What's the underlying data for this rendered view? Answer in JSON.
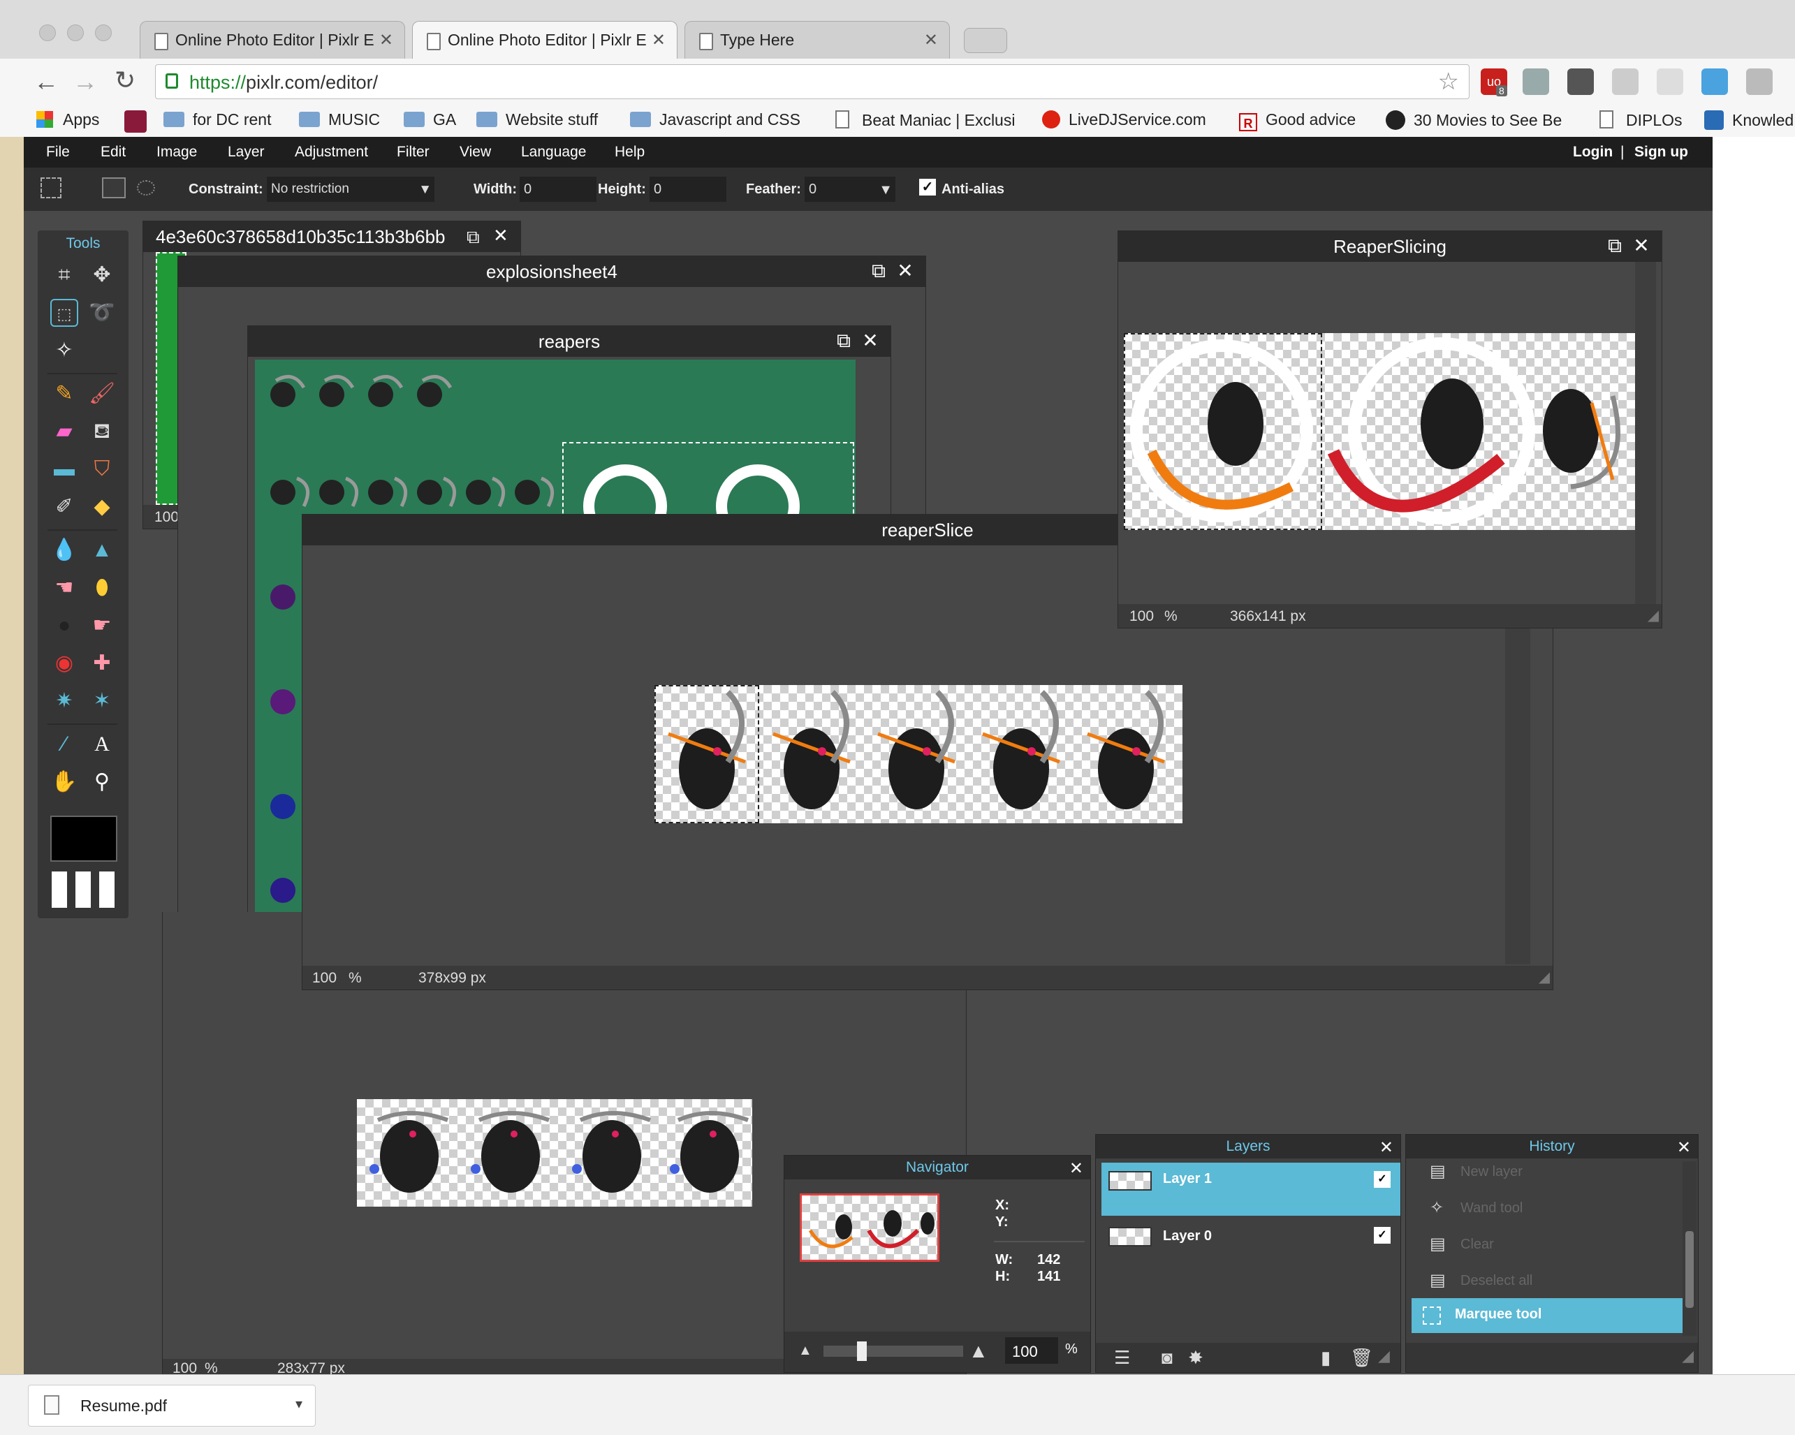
{
  "browser": {
    "tabs": [
      {
        "label": "Online Photo Editor | Pixlr E"
      },
      {
        "label": "Online Photo Editor | Pixlr E"
      },
      {
        "label": "Type Here"
      }
    ],
    "url_scheme": "https://",
    "url_rest": "pixlr.com/editor/",
    "bookmarks": [
      {
        "label": "Apps",
        "icon": "apps-grid-icon"
      },
      {
        "label": "",
        "icon": "ext-icon"
      },
      {
        "label": "for DC rent",
        "icon": "folder-icon"
      },
      {
        "label": "MUSIC",
        "icon": "folder-icon"
      },
      {
        "label": "GA",
        "icon": "folder-icon"
      },
      {
        "label": "Website stuff",
        "icon": "folder-icon"
      },
      {
        "label": "Javascript and CSS",
        "icon": "folder-icon"
      },
      {
        "label": "Beat Maniac | Exclusi",
        "icon": "page-icon"
      },
      {
        "label": "LiveDJService.com",
        "icon": "red-dot-icon"
      },
      {
        "label": "Good advice",
        "icon": "r-icon"
      },
      {
        "label": "30 Movies to See Be",
        "icon": "page-icon"
      },
      {
        "label": "DIPLOs",
        "icon": "page-icon"
      },
      {
        "label": "Knowled",
        "icon": "page-icon"
      }
    ],
    "ext_badge": "8"
  },
  "pixlr": {
    "menu": [
      "File",
      "Edit",
      "Image",
      "Layer",
      "Adjustment",
      "Filter",
      "View",
      "Language",
      "Help"
    ],
    "login": "Login",
    "separator": "|",
    "signup": "Sign up",
    "options": {
      "constraint_label": "Constraint:",
      "constraint_value": "No restriction",
      "width_label": "Width:",
      "width_value": "0",
      "height_label": "Height:",
      "height_value": "0",
      "feather_label": "Feather:",
      "feather_value": "0",
      "antialias_label": "Anti-alias",
      "antialias_checked": true
    },
    "tools_title": "Tools",
    "windows": {
      "hash": {
        "title": "4e3e60c378658d10b35c113b3b6bb",
        "zoom": "100"
      },
      "explosion": {
        "title": "explosionsheet4"
      },
      "reapers": {
        "title": "reapers"
      },
      "reaperSlice": {
        "title": "reaperSlice",
        "zoom": "100",
        "zoom_unit": "%",
        "size": "378x99 px"
      },
      "reaperSlicing": {
        "title": "ReaperSlicing",
        "zoom": "100",
        "zoom_unit": "%",
        "size": "366x141 px"
      },
      "bottom": {
        "zoom": "100",
        "zoom_unit": "%",
        "size": "283x77 px"
      }
    },
    "navigator": {
      "title": "Navigator",
      "x_label": "X:",
      "y_label": "Y:",
      "w_label": "W:",
      "h_label": "H:",
      "w_value": "142",
      "h_value": "141",
      "zoom": "100",
      "zoom_unit": "%"
    },
    "layers": {
      "title": "Layers",
      "items": [
        {
          "name": "Layer 1",
          "selected": true,
          "visible": true
        },
        {
          "name": "Layer 0",
          "selected": false,
          "visible": true
        }
      ]
    },
    "history": {
      "title": "History",
      "items": [
        {
          "label": "New layer",
          "active": false
        },
        {
          "label": "Wand tool",
          "active": false
        },
        {
          "label": "Clear",
          "active": false
        },
        {
          "label": "Deselect all",
          "active": false
        },
        {
          "label": "Marquee tool",
          "active": true
        }
      ]
    }
  },
  "downloads": {
    "file": "Resume.pdf"
  },
  "colors": {
    "accent": "#5bbad5",
    "canvas_green": "#2a7a55",
    "orange": "#f07c10",
    "red": "#d01f2a"
  }
}
